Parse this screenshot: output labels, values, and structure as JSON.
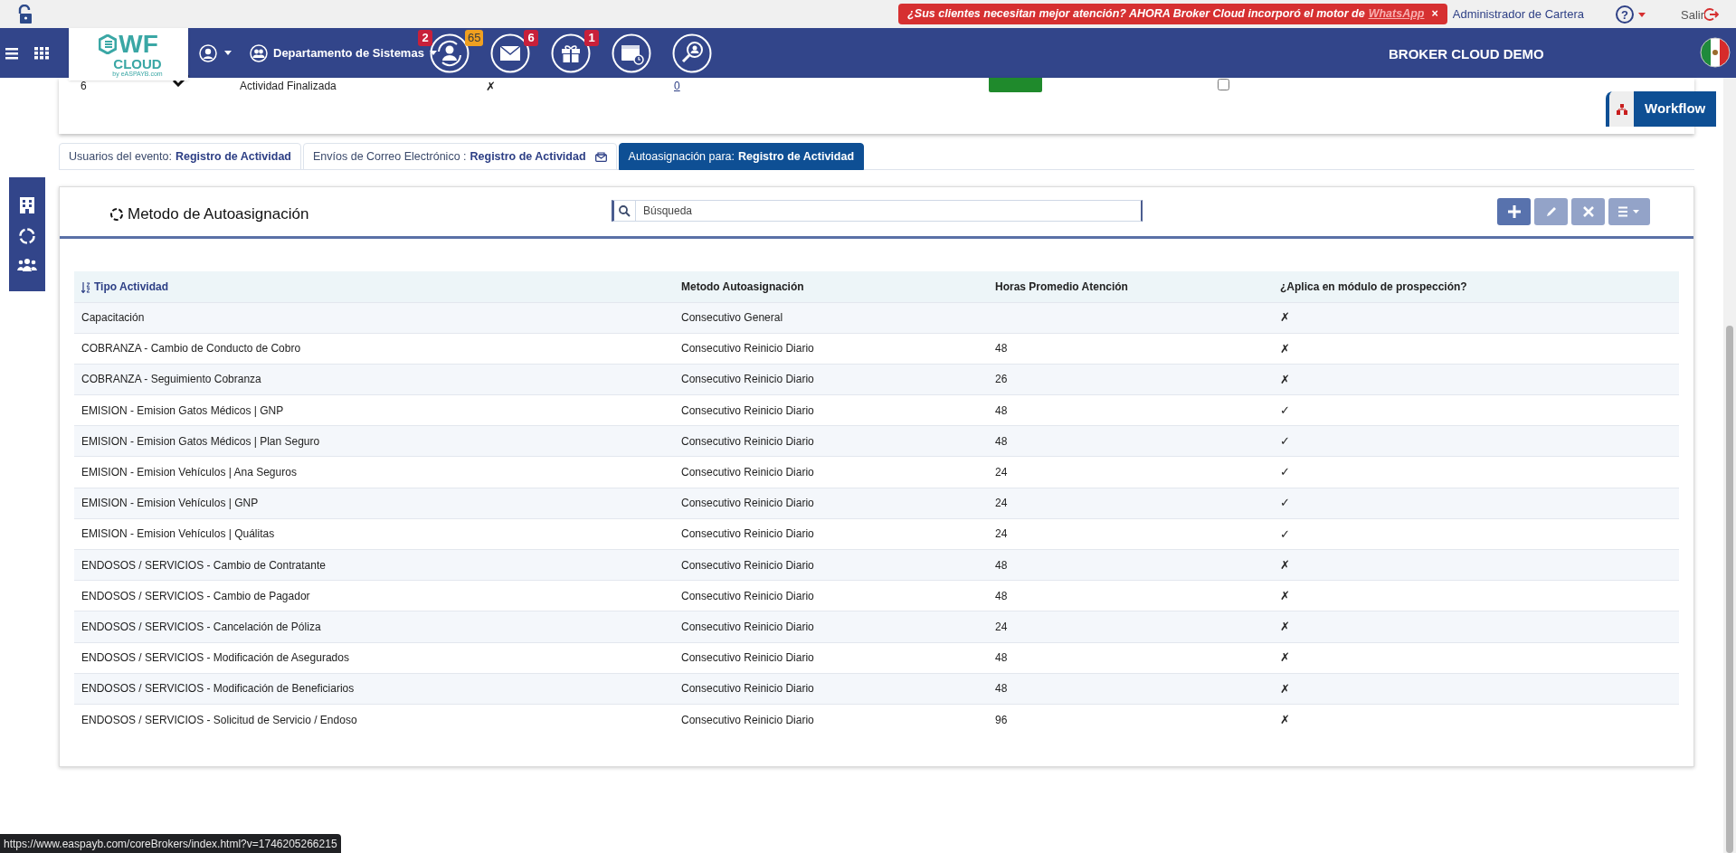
{
  "top_strip": {
    "promo": {
      "text": "¿Sus clientes necesitan mejor atención? AHORA Broker Cloud incorporó el motor de",
      "link": "WhatsApp",
      "close": "×"
    },
    "role": "Administrador de Cartera",
    "help": "?",
    "logout": "Salir"
  },
  "navbar": {
    "logo": {
      "main": "WF",
      "sub": "CLOUD",
      "by": "by eASPAYB.com"
    },
    "department": "Departamento de Sistemas",
    "icons": [
      {
        "kind": "assign",
        "badge": "2",
        "top_badge": "65"
      },
      {
        "kind": "mail",
        "badge": "6"
      },
      {
        "kind": "gift",
        "badge": "1"
      },
      {
        "kind": "calendar"
      },
      {
        "kind": "search-user"
      }
    ],
    "company": "BROKER CLOUD DEMO"
  },
  "previous_row": {
    "number": "6",
    "status_text": "Actividad Finalizada",
    "mark": "✗",
    "link": "0",
    "checked": false
  },
  "workflow_button": "Workflow",
  "tabs": [
    {
      "label": "Usuarios del evento:",
      "bold": "Registro de Actividad",
      "selected": false,
      "mail_icon": false
    },
    {
      "label": "Envíos de Correo Electrónico :",
      "bold": "Registro de Actividad",
      "selected": false,
      "mail_icon": true
    },
    {
      "label": "Autoasignación para:",
      "bold": "Registro de Actividad",
      "selected": true,
      "mail_icon": false
    }
  ],
  "panel": {
    "title": "Metodo de Autoasignación",
    "search": {
      "placeholder": "Búsqueda"
    },
    "buttons": [
      {
        "kind": "add",
        "disabled": false
      },
      {
        "kind": "edit",
        "disabled": true
      },
      {
        "kind": "delete",
        "disabled": true
      },
      {
        "kind": "menu",
        "disabled": true
      }
    ]
  },
  "table": {
    "columns": [
      "Tipo Actividad",
      "Metodo Autoasignación",
      "Horas Promedio Atención",
      "¿Aplica en módulo de prospección?"
    ],
    "rows": [
      {
        "tipo": "Capacitación",
        "metodo": "Consecutivo General",
        "aplica": "✗"
      },
      {
        "tipo": "COBRANZA - Cambio de Conducto de Cobro",
        "metodo": "Consecutivo Reinicio Diario",
        "horas": "48",
        "aplica": "✗"
      },
      {
        "tipo": "COBRANZA - Seguimiento Cobranza",
        "metodo": "Consecutivo Reinicio Diario",
        "horas": "26",
        "aplica": "✗"
      },
      {
        "tipo": "EMISION - Emision Gatos Médicos | GNP",
        "metodo": "Consecutivo Reinicio Diario",
        "horas": "48",
        "aplica": "✓"
      },
      {
        "tipo": "EMISION - Emision Gatos Médicos | Plan Seguro",
        "metodo": "Consecutivo Reinicio Diario",
        "horas": "48",
        "aplica": "✓"
      },
      {
        "tipo": "EMISION - Emision Vehículos | Ana Seguros",
        "metodo": "Consecutivo Reinicio Diario",
        "horas": "24",
        "aplica": "✓"
      },
      {
        "tipo": "EMISION - Emision Vehículos | GNP",
        "metodo": "Consecutivo Reinicio Diario",
        "horas": "24",
        "aplica": "✓"
      },
      {
        "tipo": "EMISION - Emision Vehículos | Quálitas",
        "metodo": "Consecutivo Reinicio Diario",
        "horas": "24",
        "aplica": "✓"
      },
      {
        "tipo": "ENDOSOS / SERVICIOS - Cambio de Contratante",
        "metodo": "Consecutivo Reinicio Diario",
        "horas": "48",
        "aplica": "✗"
      },
      {
        "tipo": "ENDOSOS / SERVICIOS - Cambio de Pagador",
        "metodo": "Consecutivo Reinicio Diario",
        "horas": "48",
        "aplica": "✗"
      },
      {
        "tipo": "ENDOSOS / SERVICIOS - Cancelación de Póliza",
        "metodo": "Consecutivo Reinicio Diario",
        "horas": "24",
        "aplica": "✗"
      },
      {
        "tipo": "ENDOSOS / SERVICIOS - Modificación de Asegurados",
        "metodo": "Consecutivo Reinicio Diario",
        "horas": "48",
        "aplica": "✗"
      },
      {
        "tipo": "ENDOSOS / SERVICIOS - Modificación de Beneficiarios",
        "metodo": "Consecutivo Reinicio Diario",
        "horas": "48",
        "aplica": "✗"
      },
      {
        "tipo": "ENDOSOS / SERVICIOS - Solicitud de Servicio / Endoso",
        "metodo": "Consecutivo Reinicio Diario",
        "horas": "96",
        "aplica": "✗"
      }
    ]
  },
  "status_url": "https://www.easpayb.com/coreBrokers/index.html?v=1746205266215"
}
